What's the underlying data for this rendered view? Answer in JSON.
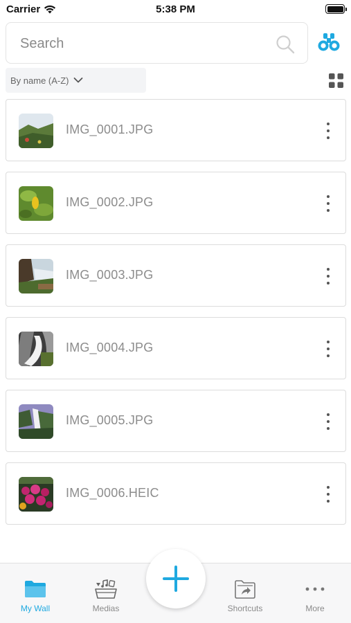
{
  "status_bar": {
    "carrier": "Carrier",
    "time": "5:38 PM"
  },
  "search": {
    "placeholder": "Search",
    "value": ""
  },
  "sort": {
    "label": "By name (A-Z)"
  },
  "files": [
    {
      "name": "IMG_0001.JPG"
    },
    {
      "name": "IMG_0002.JPG"
    },
    {
      "name": "IMG_0003.JPG"
    },
    {
      "name": "IMG_0004.JPG"
    },
    {
      "name": "IMG_0005.JPG"
    },
    {
      "name": "IMG_0006.HEIC"
    }
  ],
  "tabs": [
    {
      "label": "My Wall",
      "icon": "folder-icon",
      "active": true
    },
    {
      "label": "Medias",
      "icon": "media-basket-icon",
      "active": false
    },
    {
      "label": "Shortcuts",
      "icon": "shortcut-folder-icon",
      "active": false
    },
    {
      "label": "More",
      "icon": "more-horizontal-icon",
      "active": false
    }
  ],
  "colors": {
    "accent": "#1fa9e0",
    "text_muted": "#8c8c8c",
    "border": "#dcdcdc"
  }
}
